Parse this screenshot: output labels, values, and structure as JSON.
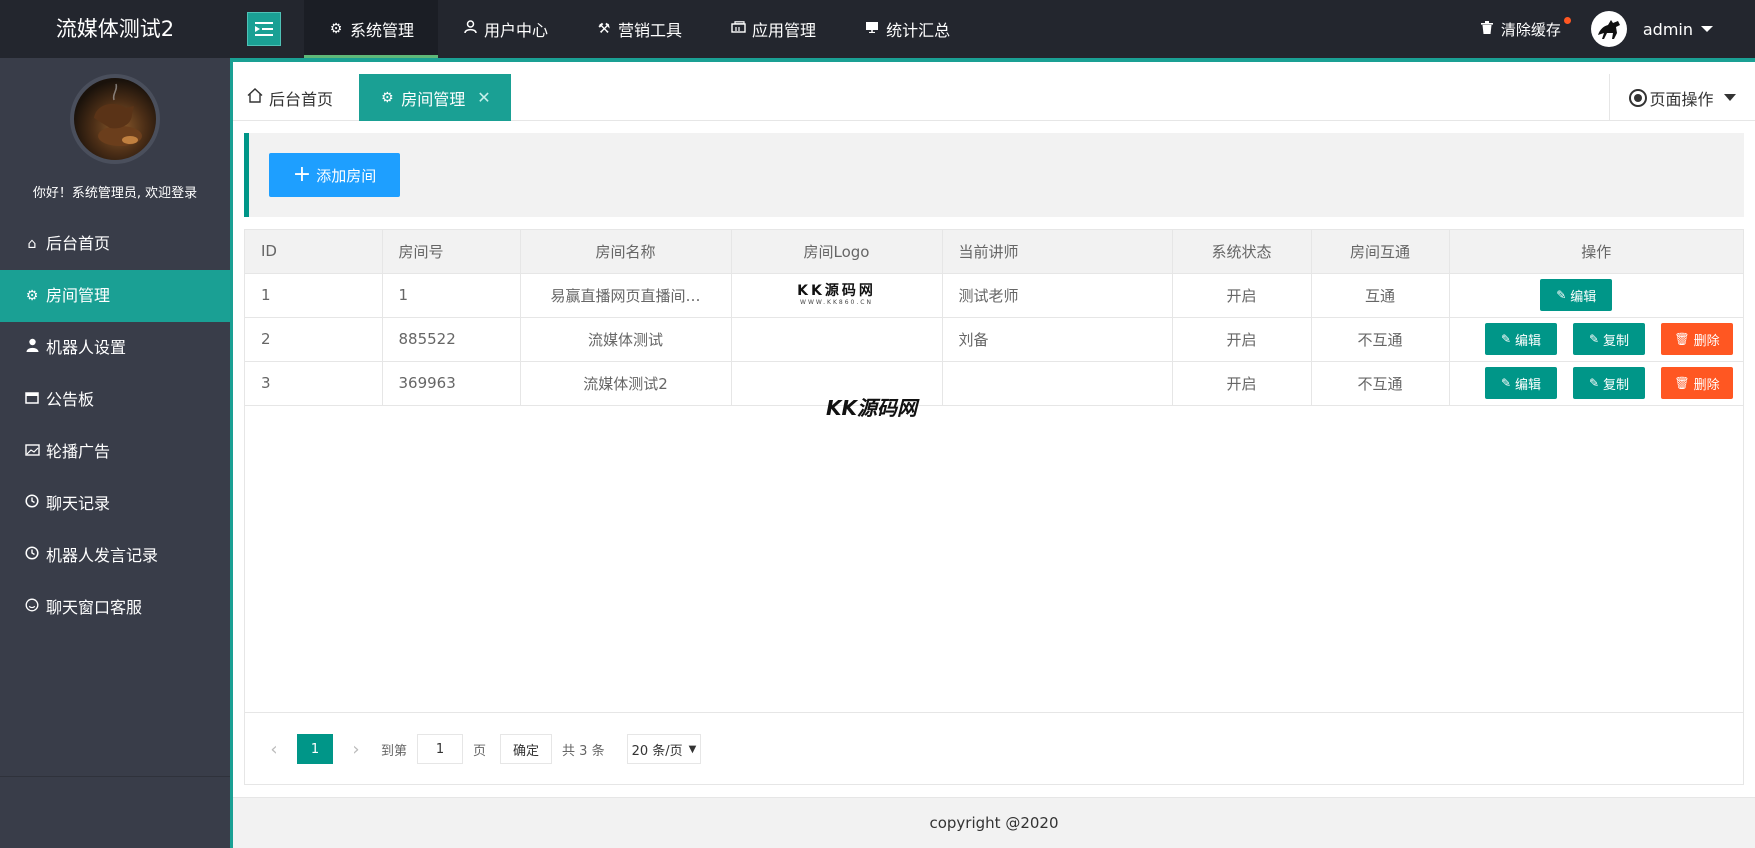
{
  "app": {
    "title": "流媒体测试2"
  },
  "topnav": {
    "items": [
      {
        "label": "系统管理",
        "icon": "gear-icon",
        "active": true
      },
      {
        "label": "用户中心",
        "icon": "user-icon",
        "active": false
      },
      {
        "label": "营销工具",
        "icon": "tools-icon",
        "active": false
      },
      {
        "label": "应用管理",
        "icon": "app-icon",
        "active": false
      },
      {
        "label": "统计汇总",
        "icon": "stats-icon",
        "active": false
      }
    ],
    "clear_cache": "清除缓存",
    "username": "admin"
  },
  "sidebar": {
    "welcome": "你好！系统管理员, 欢迎登录",
    "items": [
      {
        "label": "后台首页",
        "icon": "home-icon"
      },
      {
        "label": "房间管理",
        "icon": "gear-icon",
        "active": true
      },
      {
        "label": "机器人设置",
        "icon": "user-icon"
      },
      {
        "label": "公告板",
        "icon": "board-icon"
      },
      {
        "label": "轮播广告",
        "icon": "image-icon"
      },
      {
        "label": "聊天记录",
        "icon": "clock-icon"
      },
      {
        "label": "机器人发言记录",
        "icon": "clock-icon"
      },
      {
        "label": "聊天窗口客服",
        "icon": "smile-icon"
      }
    ]
  },
  "tabs": {
    "home": "后台首页",
    "room": "房间管理",
    "close": "✕",
    "page_ops": "页面操作"
  },
  "toolbar": {
    "add_room": "添加房间",
    "plus": "+"
  },
  "table": {
    "headers": [
      "ID",
      "房间号",
      "房间名称",
      "房间Logo",
      "当前讲师",
      "系统状态",
      "房间互通",
      "操作"
    ],
    "rows": [
      {
        "id": "1",
        "room_no": "1",
        "name": "易赢直播网页直播间…",
        "logo_text": "KK源码网",
        "logo_sub": "WWW.KK860.CN",
        "teacher": "测试老师",
        "status": "开启",
        "interconnect": "互通"
      },
      {
        "id": "2",
        "room_no": "885522",
        "name": "流媒体测试",
        "logo_text": "",
        "logo_sub": "",
        "teacher": "刘备",
        "status": "开启",
        "interconnect": "不互通"
      },
      {
        "id": "3",
        "room_no": "369963",
        "name": "流媒体测试2",
        "logo_text": "",
        "logo_sub": "",
        "teacher": "",
        "status": "开启",
        "interconnect": "不互通"
      }
    ],
    "actions": {
      "edit": "编辑",
      "copy": "复制",
      "delete": "删除"
    }
  },
  "pager": {
    "current": "1",
    "goto_label": "到第",
    "goto_value": "1",
    "page_label": "页",
    "confirm": "确定",
    "total": "共 3 条",
    "per_page": "20 条/页"
  },
  "watermark": "KK源码网",
  "footer": {
    "copyright": "copyright @2020"
  },
  "colors": {
    "header": "#23262e",
    "sidebar": "#393d49",
    "accent": "#1aa094",
    "primary": "#009688",
    "blue": "#1e9fff",
    "danger": "#ff5722"
  }
}
